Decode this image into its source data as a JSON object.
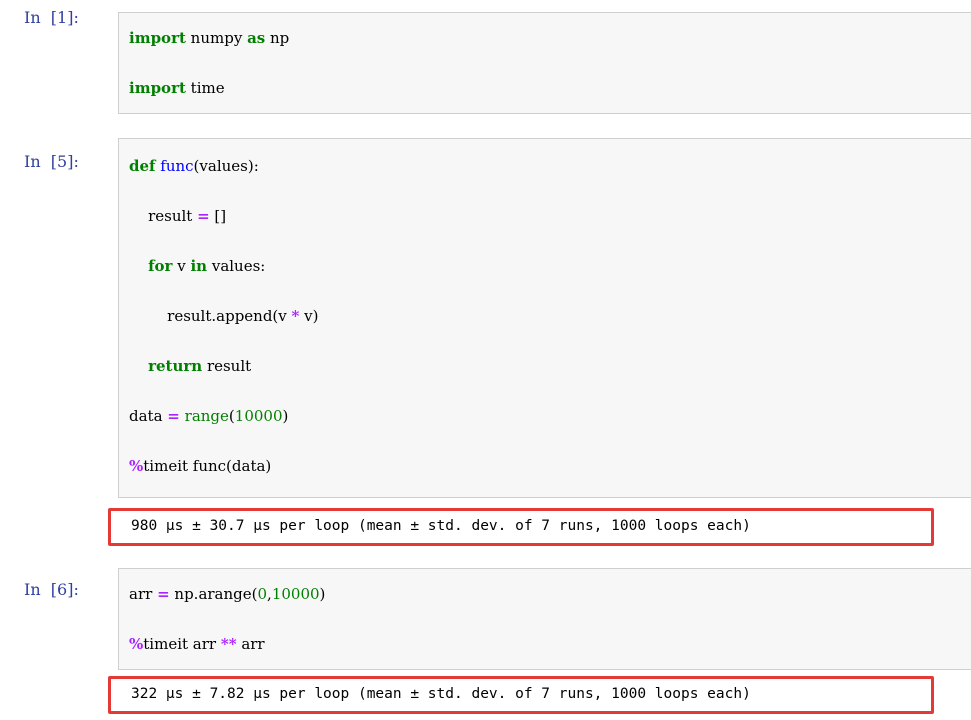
{
  "cells": [
    {
      "prompt": "In  [1]:",
      "lines": [
        [
          {
            "t": "import",
            "c": "kw"
          },
          {
            "t": " numpy ",
            "c": ""
          },
          {
            "t": "as",
            "c": "kw"
          },
          {
            "t": " np",
            "c": ""
          }
        ],
        [
          {
            "t": "import",
            "c": "kw"
          },
          {
            "t": " time",
            "c": ""
          }
        ]
      ]
    },
    {
      "prompt": "In  [5]:",
      "lines": [
        [
          {
            "t": "def",
            "c": "kw"
          },
          {
            "t": " ",
            "c": ""
          },
          {
            "t": "func",
            "c": "fn"
          },
          {
            "t": "(values):",
            "c": ""
          }
        ],
        [
          {
            "t": "    result ",
            "c": ""
          },
          {
            "t": "=",
            "c": "op"
          },
          {
            "t": " []",
            "c": ""
          }
        ],
        [
          {
            "t": "    ",
            "c": ""
          },
          {
            "t": "for",
            "c": "kw"
          },
          {
            "t": " v ",
            "c": ""
          },
          {
            "t": "in",
            "c": "kw"
          },
          {
            "t": " values:",
            "c": ""
          }
        ],
        [
          {
            "t": "        result.append(v ",
            "c": ""
          },
          {
            "t": "*",
            "c": "op"
          },
          {
            "t": " v)",
            "c": ""
          }
        ],
        [
          {
            "t": "    ",
            "c": ""
          },
          {
            "t": "return",
            "c": "kw"
          },
          {
            "t": " result",
            "c": ""
          }
        ],
        [
          {
            "t": "data ",
            "c": ""
          },
          {
            "t": "=",
            "c": "op"
          },
          {
            "t": " ",
            "c": ""
          },
          {
            "t": "range",
            "c": "bi"
          },
          {
            "t": "(",
            "c": ""
          },
          {
            "t": "10000",
            "c": "num"
          },
          {
            "t": ")",
            "c": ""
          }
        ],
        [
          {
            "t": "%",
            "c": "magic"
          },
          {
            "t": "timeit func(data)",
            "c": ""
          }
        ]
      ],
      "output": "980 µs ± 30.7 µs per loop (mean ± std. dev. of 7 runs, 1000 loops each)"
    },
    {
      "prompt": "In  [6]:",
      "lines": [
        [
          {
            "t": "arr ",
            "c": ""
          },
          {
            "t": "=",
            "c": "op"
          },
          {
            "t": " np.arange(",
            "c": ""
          },
          {
            "t": "0",
            "c": "num"
          },
          {
            "t": ",",
            "c": ""
          },
          {
            "t": "10000",
            "c": "num"
          },
          {
            "t": ")",
            "c": ""
          }
        ],
        [
          {
            "t": "%",
            "c": "magic"
          },
          {
            "t": "timeit arr ",
            "c": ""
          },
          {
            "t": "**",
            "c": "op"
          },
          {
            "t": " arr",
            "c": ""
          }
        ]
      ],
      "output": "322 µs ± 7.82 µs per loop (mean ± std. dev. of 7 runs, 1000 loops each)"
    }
  ]
}
